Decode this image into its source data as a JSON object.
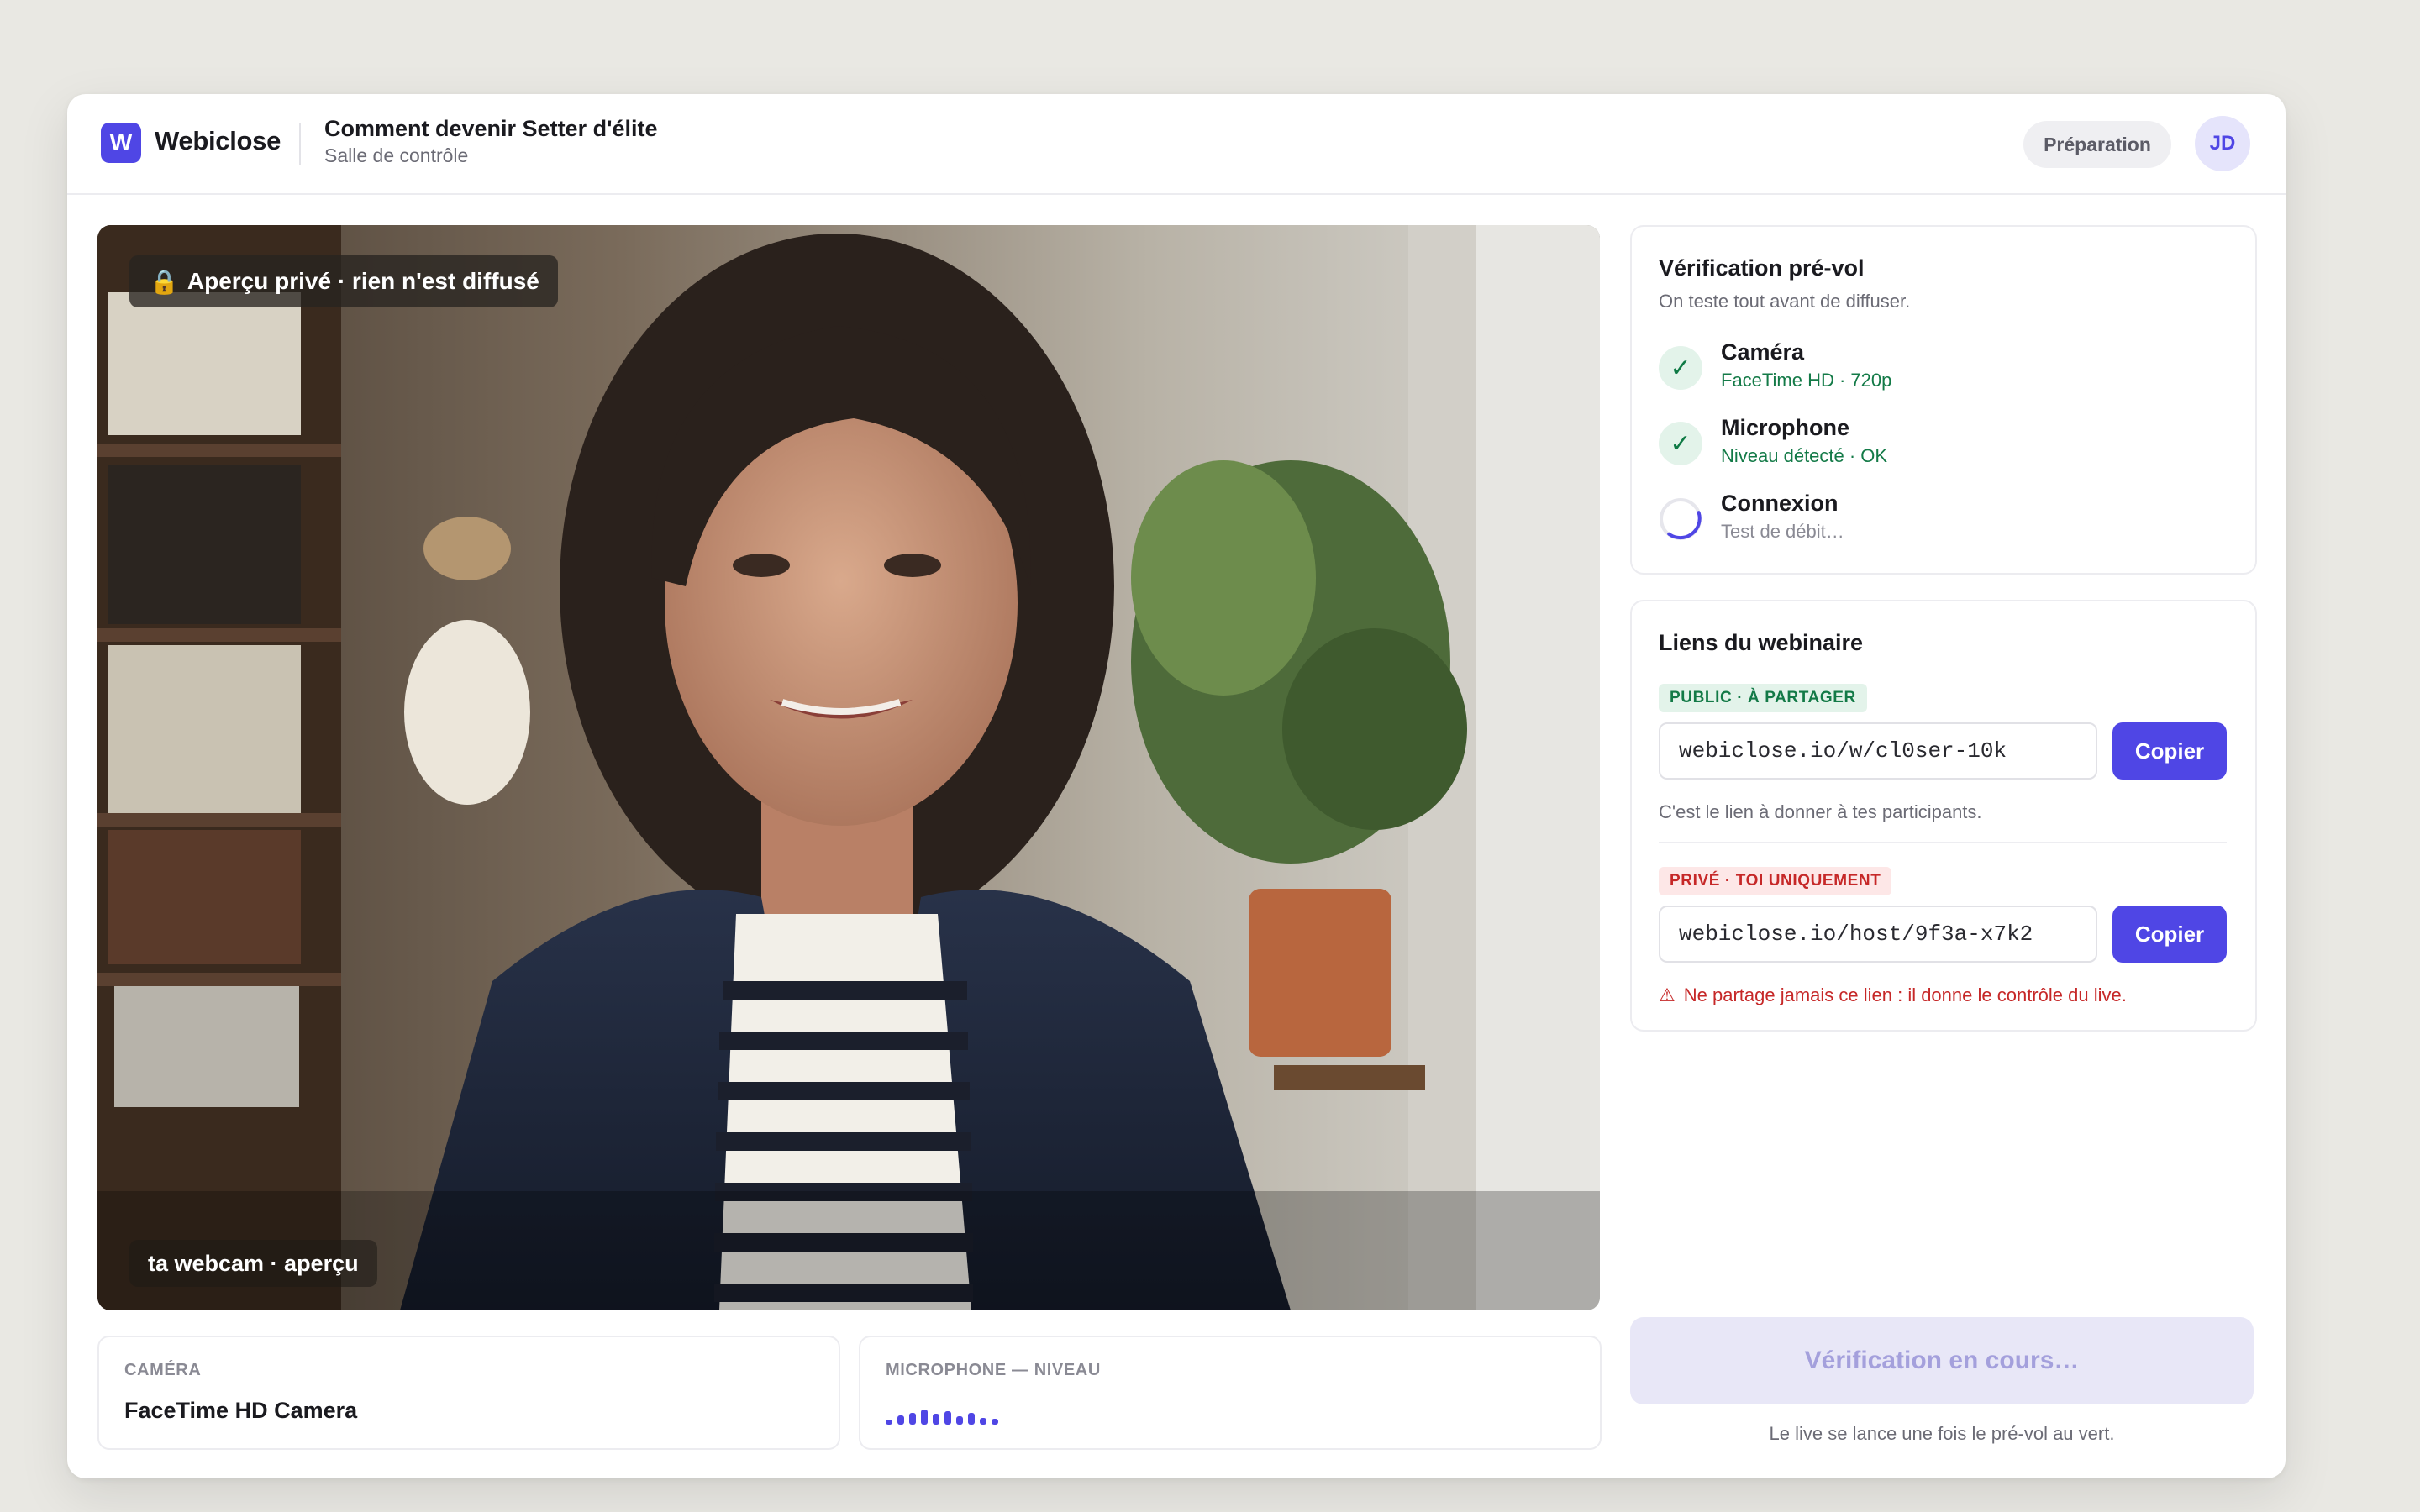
{
  "header": {
    "logo_letter": "W",
    "brand": "Webiclose",
    "event_title": "Comment devenir Setter d'élite",
    "event_subtitle": "Salle de contrôle",
    "status": "Préparation",
    "avatar_initials": "JD"
  },
  "preview": {
    "privacy_badge": "Aperçu privé · rien n'est diffusé",
    "caption": "ta webcam · aperçu"
  },
  "devices": {
    "camera_label": "CAMÉRA",
    "camera_value": "FaceTime HD Camera",
    "mic_label": "MICROPHONE — NIVEAU",
    "mic_level_bars": [
      0.35,
      0.6,
      0.8,
      1.0,
      0.7,
      0.9,
      0.55,
      0.75,
      0.45,
      0.4
    ]
  },
  "preflight": {
    "title": "Vérification pré-vol",
    "subtitle": "On teste tout avant de diffuser.",
    "checks": [
      {
        "name": "Caméra",
        "detail": "FaceTime HD · 720p",
        "state": "ok"
      },
      {
        "name": "Microphone",
        "detail": "Niveau détecté · OK",
        "state": "ok"
      },
      {
        "name": "Connexion",
        "detail": "Test de débit…",
        "state": "pending"
      }
    ]
  },
  "links": {
    "title": "Liens du webinaire",
    "public": {
      "tag": "PUBLIC · À PARTAGER",
      "url": "webiclose.io/w/cl0ser-10k",
      "copy_label": "Copier",
      "help": "C'est le lien à donner à tes participants."
    },
    "private": {
      "tag": "PRIVÉ · TOI UNIQUEMENT",
      "url": "webiclose.io/host/9f3a-x7k2",
      "copy_label": "Copier",
      "warning": "Ne partage jamais ce lien : il donne le contrôle du live."
    }
  },
  "launch": {
    "button_label": "Vérification en cours…",
    "note": "Le live se lance une fois le pré-vol au vert."
  },
  "colors": {
    "accent": "#4f46e5",
    "success": "#137a47",
    "danger": "#c62828",
    "background": "#e9e8e3"
  }
}
